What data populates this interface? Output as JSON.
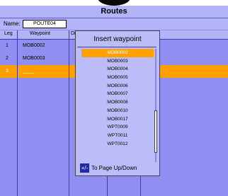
{
  "title": "Routes",
  "route": {
    "name_label": "Name:",
    "name_value": "POUTE04"
  },
  "table": {
    "headers": {
      "leg": "Leg",
      "waypoint": "Waypoint",
      "di": "Di"
    },
    "rows": [
      {
        "leg": "1",
        "waypoint": "MOB0002"
      },
      {
        "leg": "2",
        "waypoint": "MOB0003"
      },
      {
        "leg": "3",
        "waypoint": "____"
      }
    ]
  },
  "dialog": {
    "title": "Insert waypoint",
    "items": [
      "MOB0002",
      "MOB0003",
      "MOB0004",
      "MOB0005",
      "MOB0006",
      "MOB0007",
      "MOB0008",
      "MOB0010",
      "MOB0017",
      "WPT0009",
      "WPT0011",
      "WPT0012"
    ],
    "selected_index": 0,
    "hint_icon": "+/-",
    "hint_text": "To Page Up/Down"
  },
  "colors": {
    "screen_bg": "#8f8ff2",
    "header_bg": "#b3b3f7",
    "selection": "#ff9f00",
    "dialog_bg": "#bcbcf9"
  }
}
